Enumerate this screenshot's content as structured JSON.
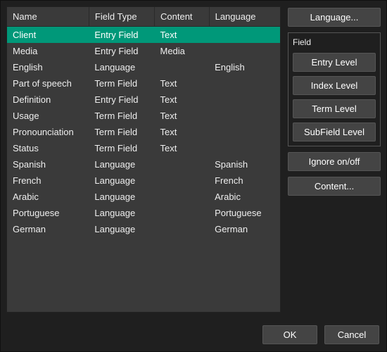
{
  "table": {
    "headers": [
      "Name",
      "Field Type",
      "Content",
      "Language"
    ],
    "rows": [
      {
        "name": "Client",
        "fieldType": "Entry Field",
        "content": "Text",
        "language": "",
        "selected": true
      },
      {
        "name": "Media",
        "fieldType": "Entry Field",
        "content": "Media",
        "language": ""
      },
      {
        "name": "English",
        "fieldType": "Language",
        "content": "",
        "language": "English"
      },
      {
        "name": "Part of speech",
        "fieldType": "Term Field",
        "content": "Text",
        "language": ""
      },
      {
        "name": "Definition",
        "fieldType": "Entry Field",
        "content": "Text",
        "language": ""
      },
      {
        "name": "Usage",
        "fieldType": "Term Field",
        "content": "Text",
        "language": ""
      },
      {
        "name": "Pronounciation",
        "fieldType": "Term Field",
        "content": "Text",
        "language": ""
      },
      {
        "name": "Status",
        "fieldType": "Term Field",
        "content": "Text",
        "language": ""
      },
      {
        "name": "Spanish",
        "fieldType": "Language",
        "content": "",
        "language": "Spanish"
      },
      {
        "name": "French",
        "fieldType": "Language",
        "content": "",
        "language": "French"
      },
      {
        "name": "Arabic",
        "fieldType": "Language",
        "content": "",
        "language": "Arabic"
      },
      {
        "name": "Portuguese",
        "fieldType": "Language",
        "content": "",
        "language": "Portuguese"
      },
      {
        "name": "German",
        "fieldType": "Language",
        "content": "",
        "language": "German"
      }
    ]
  },
  "side": {
    "language_btn": "Language...",
    "field_group_label": "Field",
    "entry_level_btn": "Entry Level",
    "index_level_btn": "Index Level",
    "term_level_btn": "Term Level",
    "subfield_level_btn": "SubField Level",
    "ignore_btn": "Ignore on/off",
    "content_btn": "Content..."
  },
  "footer": {
    "ok": "OK",
    "cancel": "Cancel"
  },
  "colors": {
    "selection": "#009879"
  }
}
